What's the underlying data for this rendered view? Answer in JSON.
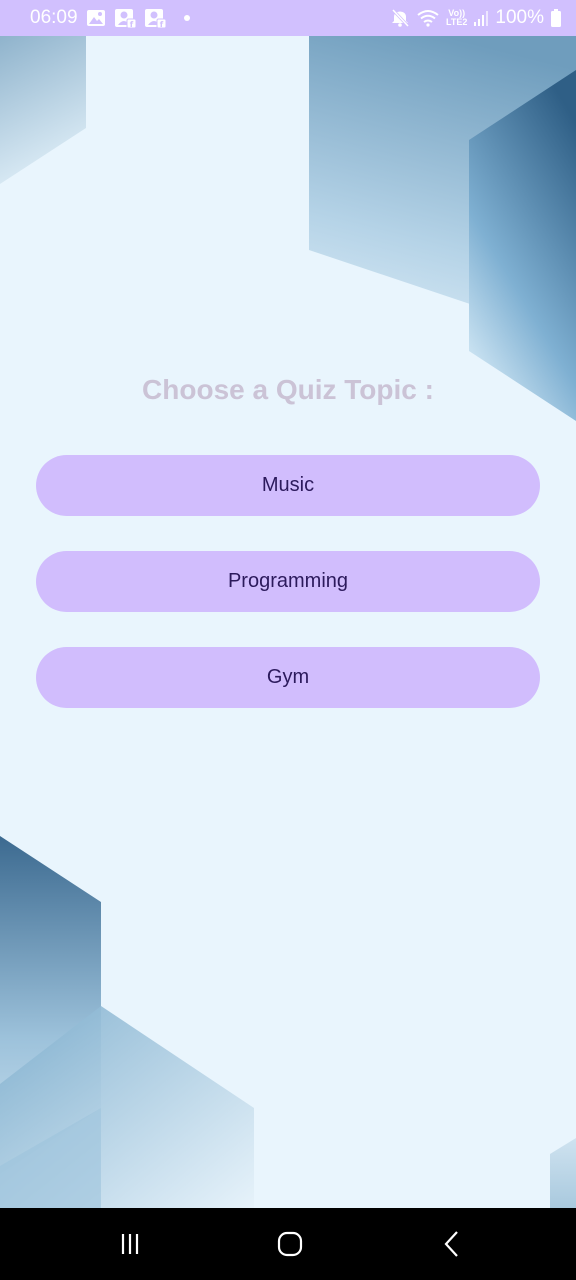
{
  "status_bar": {
    "time": "06:09",
    "network_top": "Vo))",
    "network_bottom": "LTE2",
    "battery": "100%",
    "left_icons": [
      "gallery-icon",
      "contact-facebook-icon",
      "contact-facebook-icon",
      "notification-dot"
    ],
    "right_icons": [
      "mute-icon",
      "wifi-icon",
      "lte-icon",
      "signal-icon",
      "battery-icon"
    ]
  },
  "main": {
    "title": "Choose a Quiz Topic :",
    "topics": [
      {
        "label": "Music"
      },
      {
        "label": "Programming"
      },
      {
        "label": "Gym"
      }
    ]
  },
  "nav_bar": {
    "icons": [
      "recent-apps-icon",
      "home-icon",
      "back-icon"
    ]
  },
  "colors": {
    "status_bar": "#d1c0fe",
    "background": "#e9f5fd",
    "button": "#d1bdfd",
    "button_text": "#2c1a5c",
    "title_text": "#cbc3d6",
    "nav_bar": "#000000"
  }
}
